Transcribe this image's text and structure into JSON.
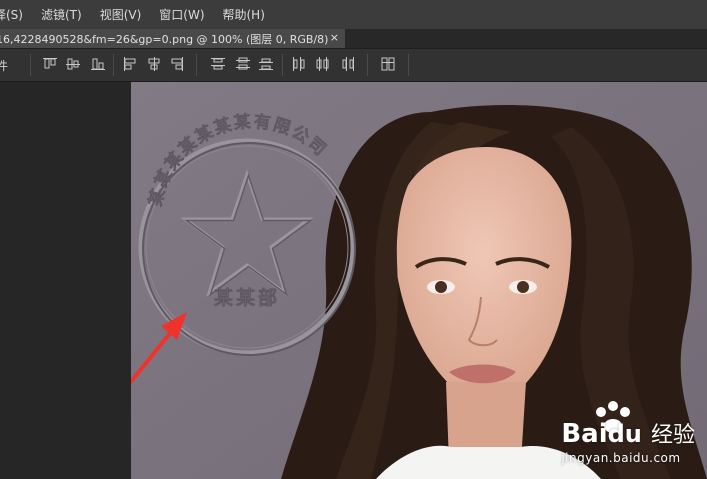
{
  "menu": {
    "items": [
      "择(S)",
      "滤镜(T)",
      "视图(V)",
      "窗口(W)",
      "帮助(H)"
    ]
  },
  "document_tab": {
    "label": "16,4228490528&fm=26&gp=0.png @ 100% (图层 0, RGB/8)",
    "close_glyph": "×"
  },
  "options_bar": {
    "label": "件",
    "icons": [
      "align-top-edges-icon",
      "align-vertical-centers-icon",
      "align-bottom-edges-icon",
      "align-left-edges-icon",
      "align-horizontal-centers-icon",
      "align-right-edges-icon",
      "distribute-top-edges-icon",
      "distribute-vertical-centers-icon",
      "distribute-bottom-edges-icon",
      "distribute-left-edges-icon",
      "distribute-horizontal-centers-icon",
      "distribute-right-edges-icon",
      "auto-align-layers-icon"
    ]
  },
  "canvas": {
    "stamp_text_top": "某某某某某某某有限公司",
    "stamp_text_bottom": "某某部",
    "watermark_logo": "Bai",
    "watermark_logo_cn": "经验",
    "watermark_url": "jingyan.baidu.com"
  },
  "colors": {
    "menubar_bg": "#3c3c3c",
    "canvas_bg": "#7d7681",
    "arrow": "#f0322d"
  }
}
